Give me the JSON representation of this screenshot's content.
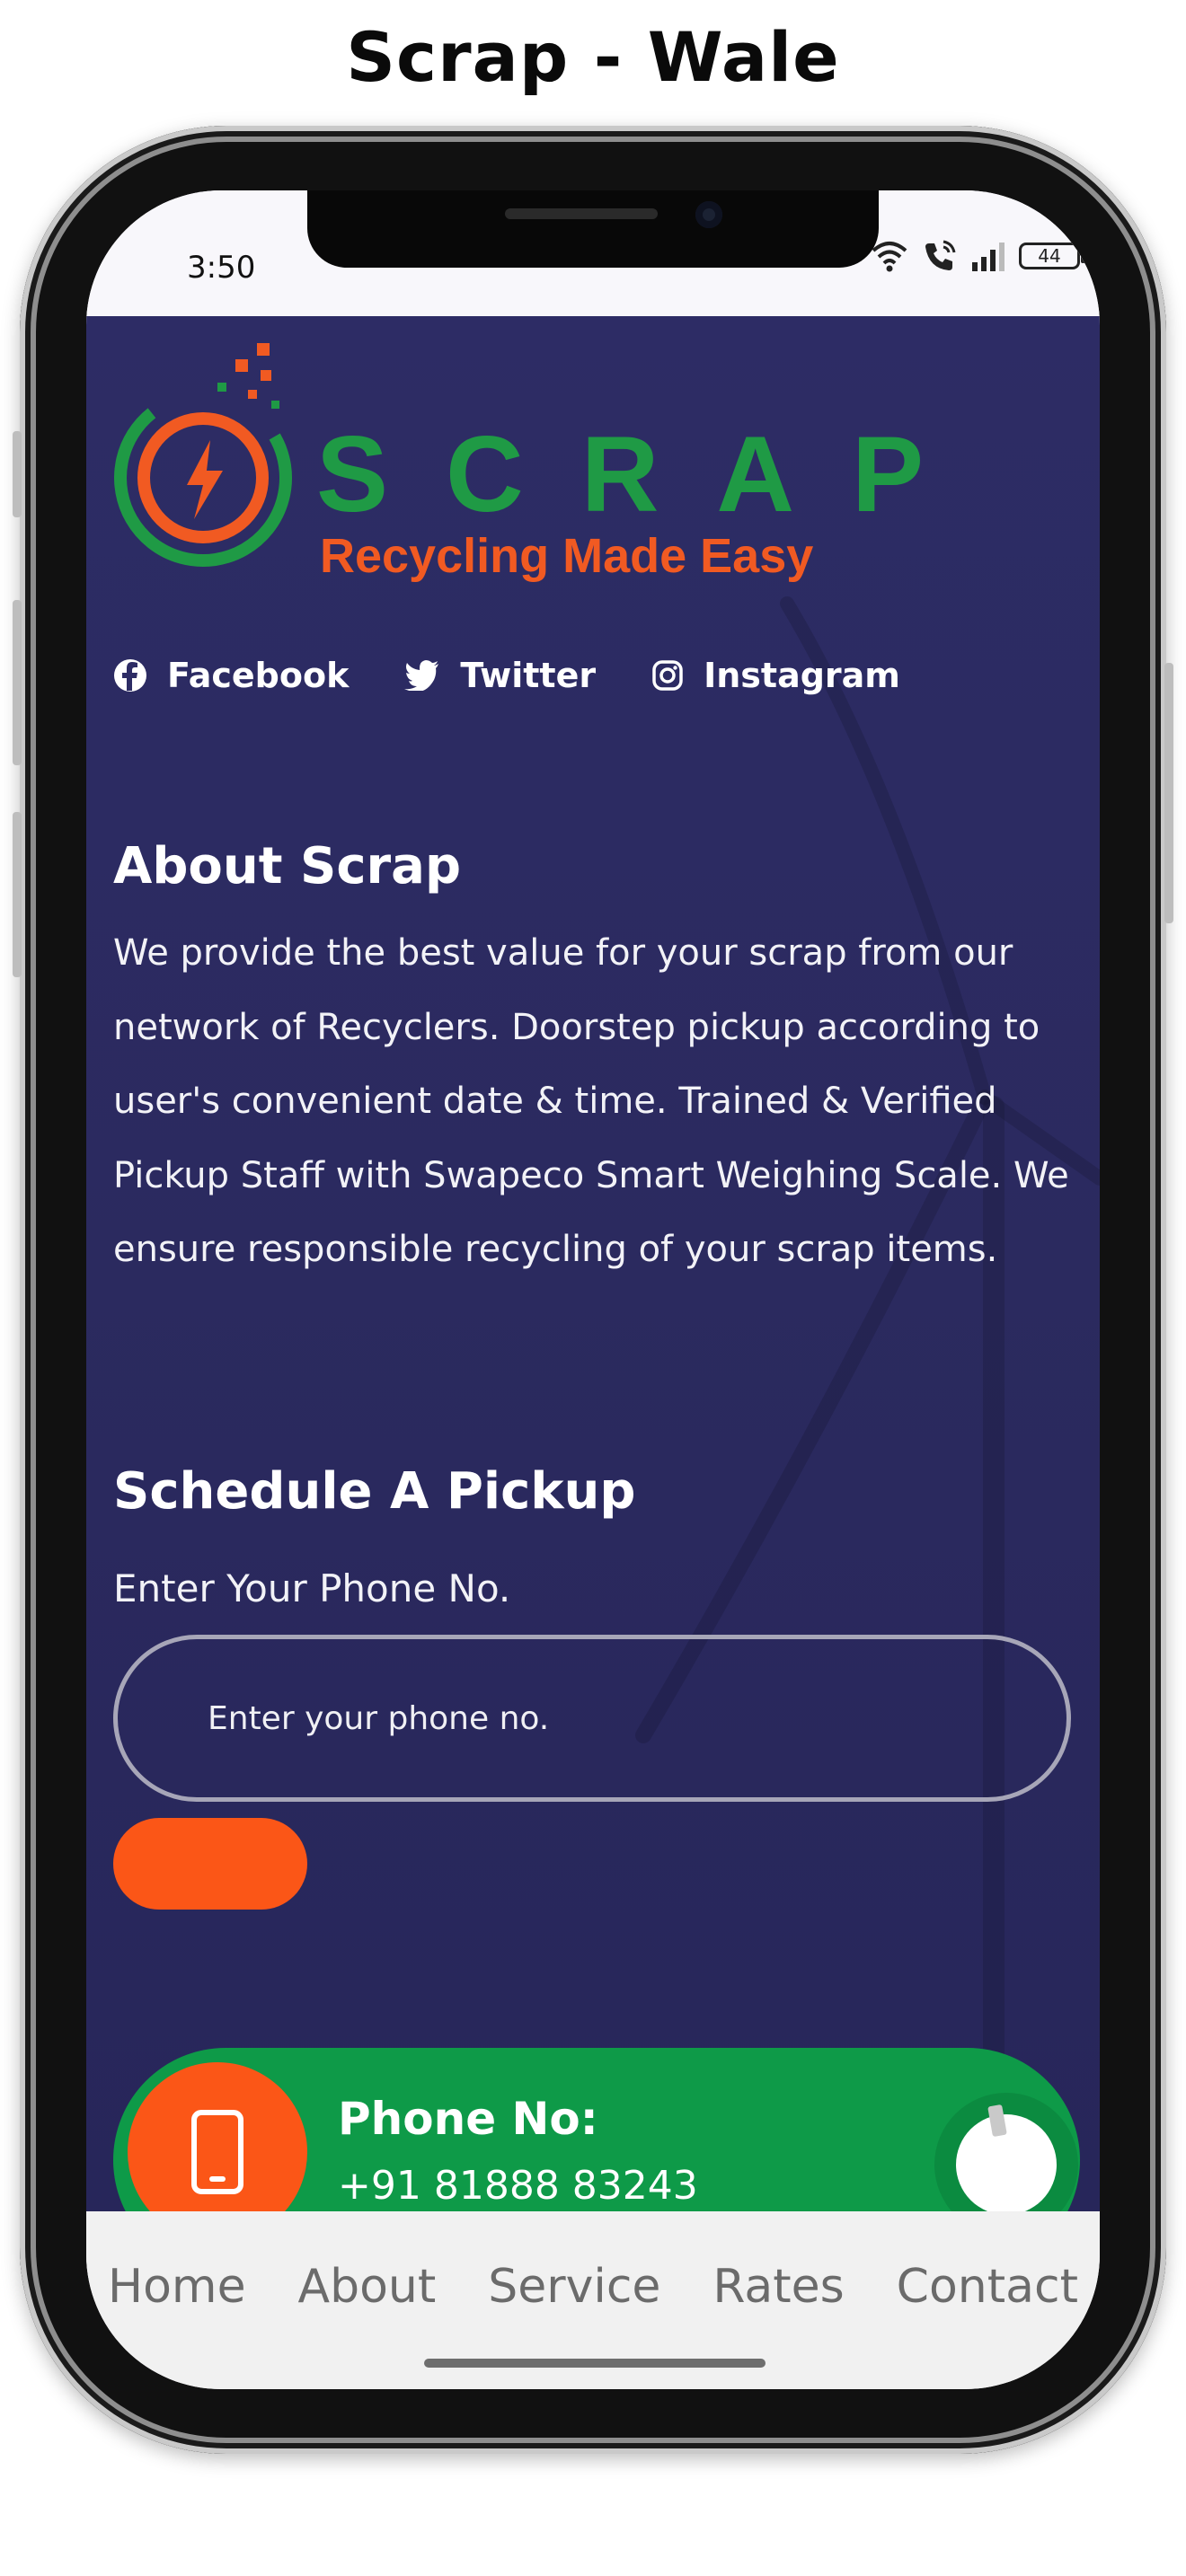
{
  "page": {
    "title": "Scrap - Wale"
  },
  "status_bar": {
    "time": "3:50",
    "battery": "44"
  },
  "logo": {
    "word": "SCRAP",
    "tagline": "Recycling Made Easy"
  },
  "social": [
    {
      "label": "Facebook",
      "icon": "facebook-icon"
    },
    {
      "label": "Twitter",
      "icon": "twitter-icon"
    },
    {
      "label": "Instagram",
      "icon": "instagram-icon"
    }
  ],
  "about": {
    "heading": "About Scrap",
    "text": "We provide the best value for your scrap from our network of Recyclers. Doorstep pickup according to user's convenient date & time. Trained & Verified Pickup Staff with Swapeco Smart Weighing Scale. We ensure responsible recycling of your scrap items."
  },
  "schedule": {
    "heading": "Schedule A Pickup",
    "label": "Enter Your Phone No.",
    "placeholder": "Enter your phone no."
  },
  "contact": {
    "title": "Phone No:",
    "number": "+91 81888 83243"
  },
  "nav": {
    "home": "Home",
    "about": "About",
    "service": "Service",
    "rates": "Rates",
    "contact": "Contact"
  },
  "colors": {
    "brand_green": "#1f9a45",
    "brand_orange": "#f15a22",
    "background_navy": "#2d2c65",
    "contact_green": "#0e9a48",
    "button_orange": "#fb5617"
  }
}
